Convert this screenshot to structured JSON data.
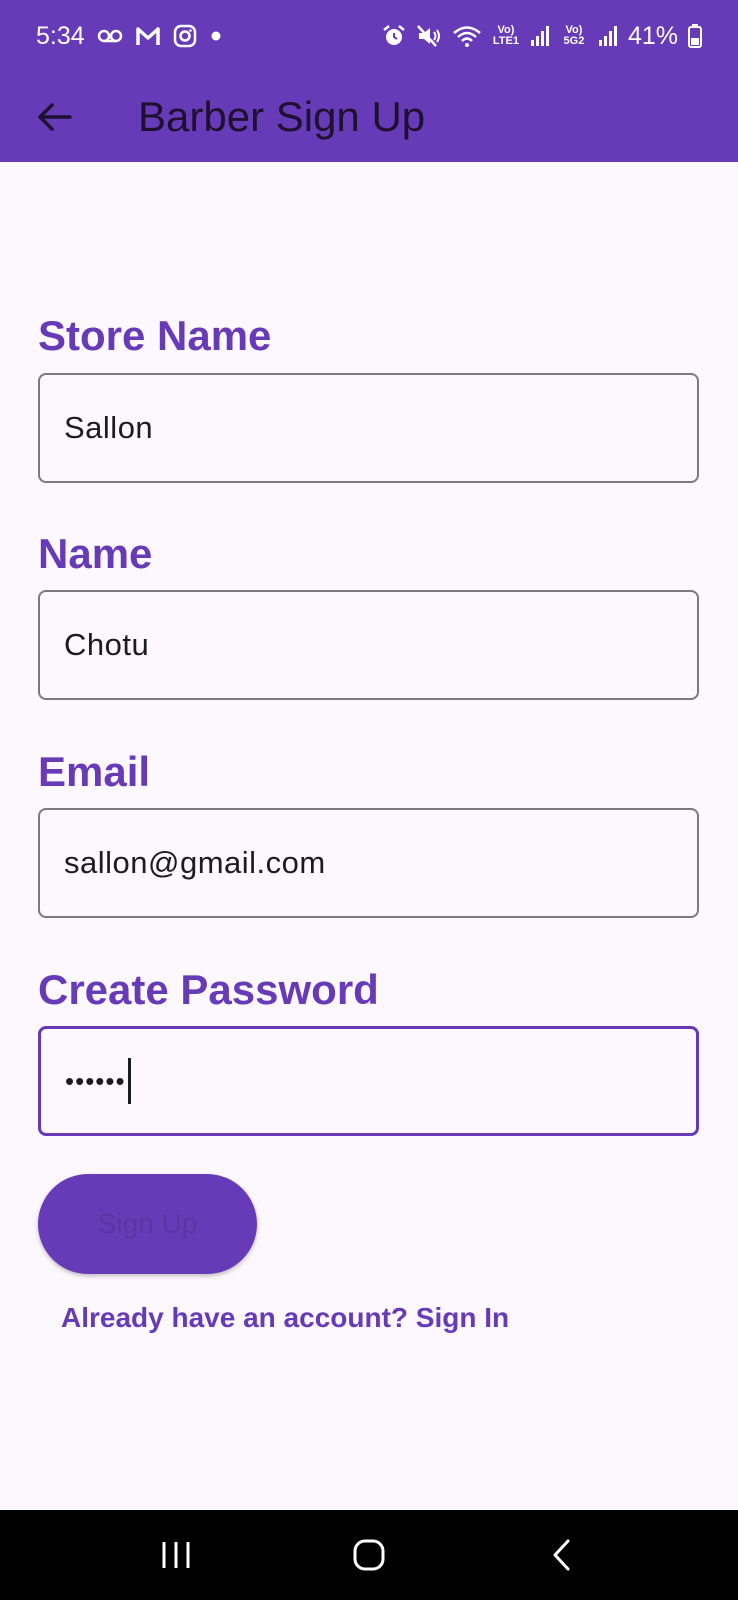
{
  "status_bar": {
    "time": "5:34",
    "battery": "41%",
    "lte_label": "Vo) LTE1",
    "g5_label": "Vo) 5G2",
    "icons": [
      "voicemail-icon",
      "gmail-icon",
      "instagram-icon",
      "dot-icon",
      "alarm-icon",
      "mute-icon",
      "wifi-icon",
      "signal-icon",
      "battery-icon"
    ]
  },
  "app_bar": {
    "title": "Barber Sign Up",
    "back_icon": "arrow-back-icon"
  },
  "form": {
    "store_name": {
      "label": "Store Name",
      "value": "Sallon"
    },
    "name": {
      "label": "Name",
      "value": "Chotu"
    },
    "email": {
      "label": "Email",
      "value": "sallon@gmail.com"
    },
    "password": {
      "label": "Create Password",
      "value": "••••••"
    }
  },
  "actions": {
    "signup_label": "Sign Up",
    "signin_link": "Already have an account? Sign In"
  },
  "nav_bar": {
    "icons": [
      "recents-icon",
      "home-icon",
      "back-icon"
    ]
  },
  "colors": {
    "accent": "#673ab7",
    "background": "#fdf7fe",
    "nav_background": "#000000"
  }
}
